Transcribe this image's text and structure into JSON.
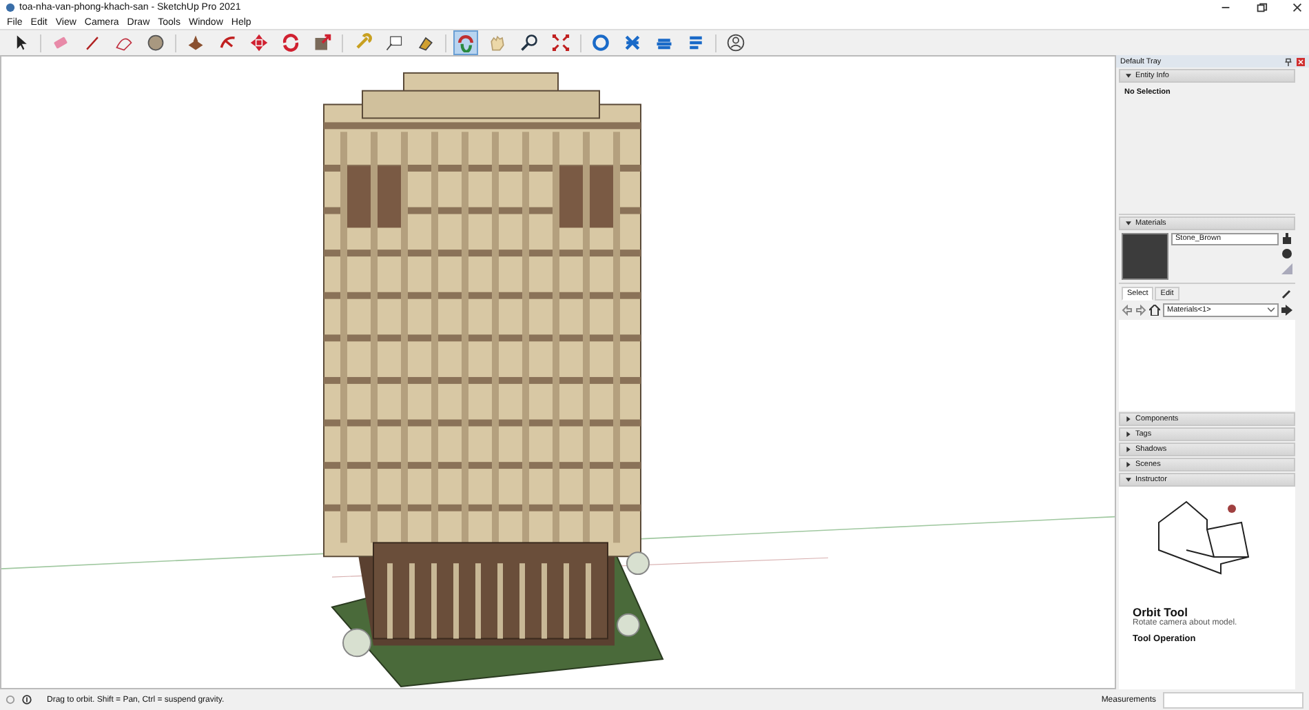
{
  "window": {
    "title": "toa-nha-van-phong-khach-san - SketchUp Pro 2021"
  },
  "menu": [
    "File",
    "Edit",
    "View",
    "Camera",
    "Draw",
    "Tools",
    "Window",
    "Help"
  ],
  "toolbar": [
    {
      "kind": "select",
      "selected": false
    },
    {
      "kind": "sep"
    },
    {
      "kind": "eraser",
      "selected": false
    },
    {
      "kind": "pencil",
      "selected": false
    },
    {
      "kind": "arc",
      "selected": false
    },
    {
      "kind": "circle",
      "selected": false
    },
    {
      "kind": "sep"
    },
    {
      "kind": "pushpull",
      "selected": false
    },
    {
      "kind": "followme",
      "selected": false
    },
    {
      "kind": "move",
      "selected": false
    },
    {
      "kind": "rotate",
      "selected": false
    },
    {
      "kind": "scale",
      "selected": false
    },
    {
      "kind": "sep"
    },
    {
      "kind": "tape",
      "selected": false
    },
    {
      "kind": "text",
      "selected": false
    },
    {
      "kind": "paint",
      "selected": false
    },
    {
      "kind": "sep"
    },
    {
      "kind": "orbit",
      "selected": true
    },
    {
      "kind": "pan",
      "selected": false
    },
    {
      "kind": "zoom",
      "selected": false
    },
    {
      "kind": "extents",
      "selected": false
    },
    {
      "kind": "sep"
    },
    {
      "kind": "warehouse",
      "selected": false
    },
    {
      "kind": "extension",
      "selected": false
    },
    {
      "kind": "cloud",
      "selected": false
    },
    {
      "kind": "layout",
      "selected": false
    },
    {
      "kind": "sep"
    },
    {
      "kind": "account",
      "selected": false
    }
  ],
  "tray": {
    "title": "Default Tray",
    "entity_info": {
      "title": "Entity Info",
      "expanded": true,
      "selection": "No Selection"
    },
    "materials": {
      "title": "Materials",
      "expanded": true,
      "name": "Stone_Brown",
      "tabs": [
        {
          "label": "Select",
          "selected": true
        },
        {
          "label": "Edit",
          "selected": false
        }
      ],
      "collection": "Materials<1>"
    },
    "collapsed": [
      {
        "title": "Components",
        "expanded": false
      },
      {
        "title": "Tags",
        "expanded": false
      },
      {
        "title": "Shadows",
        "expanded": false
      },
      {
        "title": "Scenes",
        "expanded": false
      }
    ],
    "instructor": {
      "title": "Instructor",
      "expanded": true,
      "tool": "Orbit Tool",
      "description": "Rotate camera about model.",
      "section": "Tool Operation"
    }
  },
  "status_bar": {
    "hint": "Drag to orbit. Shift = Pan, Ctrl = suspend gravity.",
    "measurements_label": "Measurements"
  }
}
